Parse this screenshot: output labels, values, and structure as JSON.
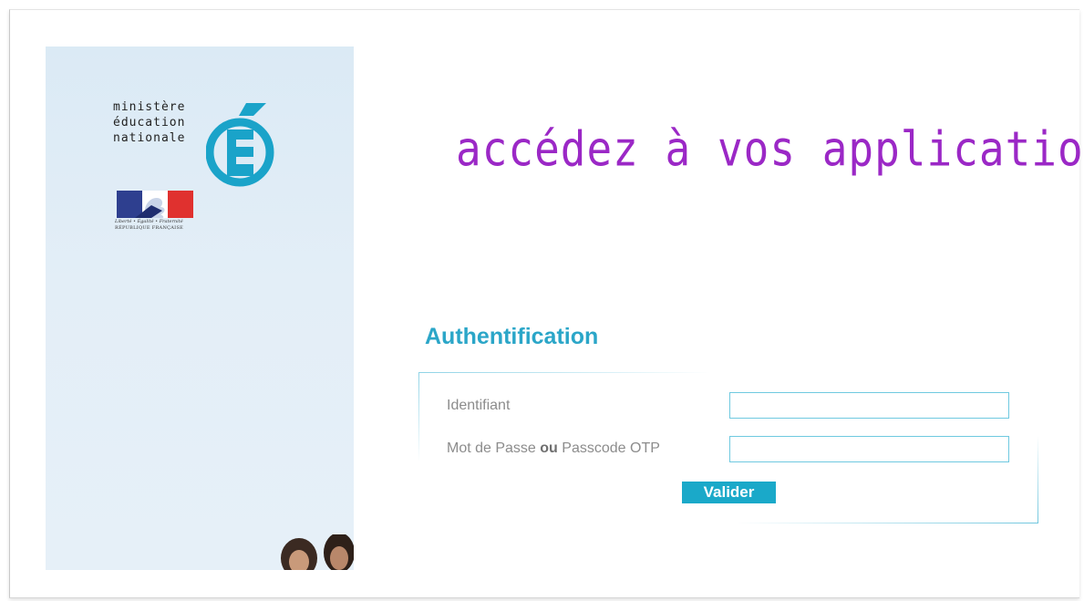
{
  "branding": {
    "ministere_lines": [
      "ministère",
      "éducation",
      "nationale"
    ],
    "republique_motto": "Liberté • Égalité • Fraternité",
    "republique_name": "RÉPUBLIQUE FRANÇAISE",
    "colors": {
      "logo_blue": "#1aa3c9",
      "flag_blue": "#2e3f8f",
      "flag_red": "#e0312f"
    }
  },
  "header": {
    "tagline": "accédez à vos applications",
    "tagline_color": "#9b28c6"
  },
  "auth": {
    "title": "Authentification",
    "username_label": "Identifiant",
    "password_label_prefix": "Mot de Passe",
    "password_label_or": "ou",
    "password_label_suffix": "Passcode OTP",
    "username_value": "",
    "password_value": "",
    "submit_label": "Valider",
    "accent_color": "#1aa9c9"
  }
}
